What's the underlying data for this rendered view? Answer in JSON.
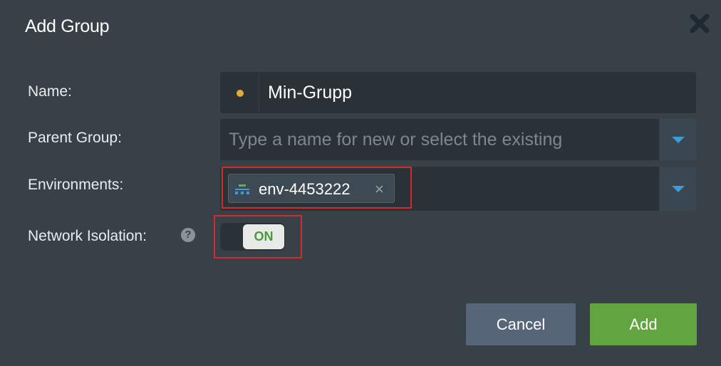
{
  "dialog": {
    "title": "Add Group",
    "close_icon": "close-icon"
  },
  "form": {
    "name": {
      "label": "Name:",
      "value": "Min-Grupp",
      "color_dot": "#e3a93a"
    },
    "parent_group": {
      "label": "Parent Group:",
      "placeholder": "Type a name for new or select the existing",
      "value": ""
    },
    "environments": {
      "label": "Environments:",
      "tags": [
        {
          "label": "env-4453222",
          "icon": "environment-icon",
          "remove": "×"
        }
      ]
    },
    "network_isolation": {
      "label": "Network Isolation:",
      "help": "?",
      "state": "ON"
    }
  },
  "buttons": {
    "cancel": "Cancel",
    "add": "Add"
  },
  "colors": {
    "background": "#394148",
    "field": "#2b3237",
    "accent_blue": "#3e9bd6",
    "add_green": "#62a43f",
    "cancel_slate": "#566578",
    "highlight_red": "#d12b2b"
  }
}
